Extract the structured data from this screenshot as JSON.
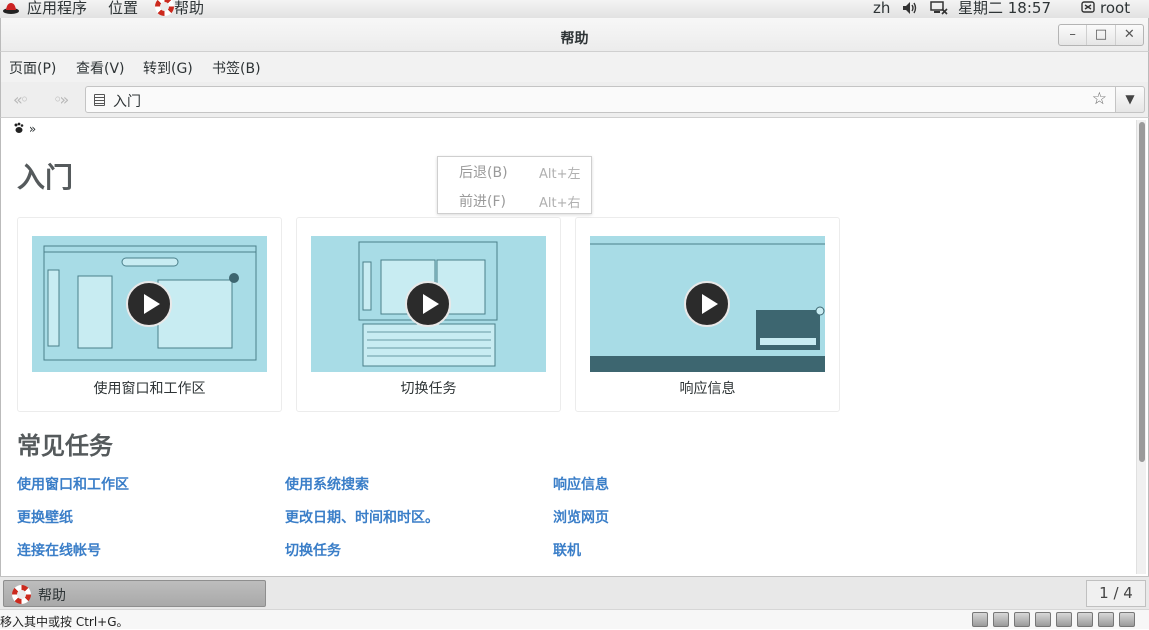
{
  "top_panel": {
    "applications": "应用程序",
    "places": "位置",
    "active_app": "帮助",
    "language": "zh",
    "clock": "星期二 18:57",
    "user": "root"
  },
  "window": {
    "title": "帮助"
  },
  "menubar": {
    "items": [
      "页面(P)",
      "查看(V)",
      "转到(G)",
      "书签(B)"
    ]
  },
  "toolbar": {
    "location": "入门"
  },
  "content": {
    "breadcrumb_sep": "»",
    "page_title": "入门",
    "videos": [
      {
        "caption": "使用窗口和工作区"
      },
      {
        "caption": "切换任务"
      },
      {
        "caption": "响应信息"
      }
    ],
    "section_title": "常见任务",
    "links": [
      [
        "使用窗口和工作区",
        "使用系统搜索",
        "响应信息"
      ],
      [
        "更换壁纸",
        "更改日期、时间和时区。",
        "浏览网页"
      ],
      [
        "连接在线帐号",
        "切换任务",
        "联机"
      ]
    ]
  },
  "popup_menu": {
    "items": [
      {
        "label": "后退(B)",
        "accel": "Alt+左"
      },
      {
        "label": "前进(F)",
        "accel": "Alt+右"
      }
    ]
  },
  "taskbar": {
    "task_label": "帮助",
    "workspace": "1 / 4"
  },
  "statusbar": {
    "text": "移入其中或按 Ctrl+G。"
  },
  "colors": {
    "link": "#3a7ec8",
    "heading": "#555a5c",
    "thumbnail_bg": "#a8dce6"
  }
}
